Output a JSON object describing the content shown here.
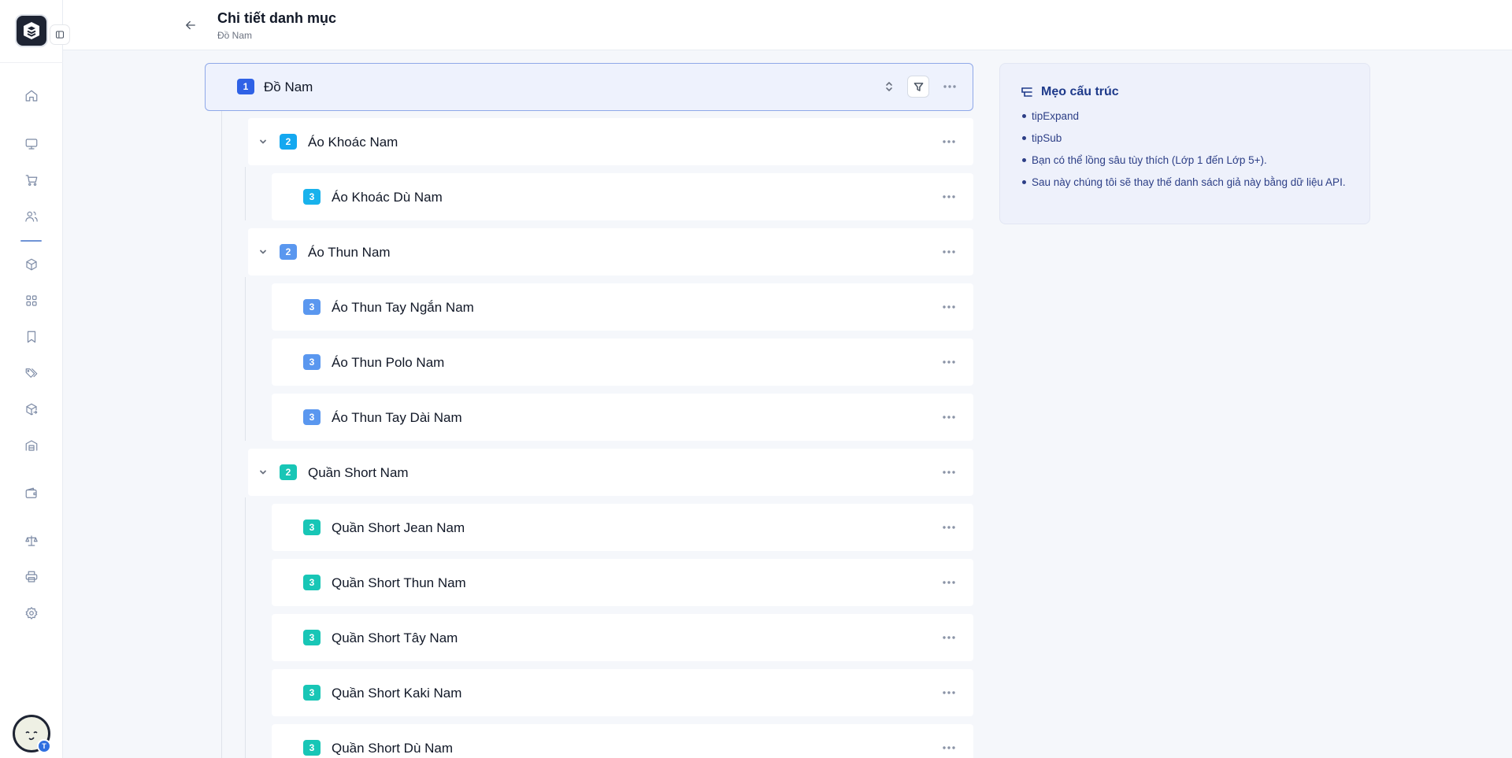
{
  "header": {
    "title": "Chi tiết danh mục",
    "subtitle": "Đồ Nam"
  },
  "sidebar": {
    "logo_icon": "layers-logo-icon",
    "avatar_badge": "T",
    "items": [
      {
        "name": "home-icon"
      },
      {
        "name": "monitor-icon"
      },
      {
        "name": "cart-icon"
      },
      {
        "name": "users-icon"
      },
      {
        "name": "box-icon"
      },
      {
        "name": "grid-icon"
      },
      {
        "name": "bookmark-icon"
      },
      {
        "name": "tags-icon"
      },
      {
        "name": "box-return-icon"
      },
      {
        "name": "warehouse-icon"
      },
      {
        "name": "wallet-icon"
      },
      {
        "name": "scale-icon"
      },
      {
        "name": "printer-icon"
      },
      {
        "name": "settings-icon"
      }
    ]
  },
  "tree": {
    "root": {
      "level": "1",
      "label": "Đồ Nam"
    },
    "items": [
      {
        "level": "2",
        "label": "Áo Khoác Nam"
      },
      {
        "level": "3",
        "label": "Áo Khoác Dù Nam"
      },
      {
        "level": "2",
        "label": "Áo Thun Nam"
      },
      {
        "level": "3",
        "label": "Áo Thun Tay Ngắn Nam"
      },
      {
        "level": "3",
        "label": "Áo Thun Polo Nam"
      },
      {
        "level": "3",
        "label": "Áo Thun Tay Dài Nam"
      },
      {
        "level": "2",
        "label": "Quần Short Nam"
      },
      {
        "level": "3",
        "label": "Quần Short Jean Nam"
      },
      {
        "level": "3",
        "label": "Quần Short Thun Nam"
      },
      {
        "level": "3",
        "label": "Quần Short Tây Nam"
      },
      {
        "level": "3",
        "label": "Quần Short Kaki Nam"
      },
      {
        "level": "3",
        "label": "Quần Short Dù Nam"
      }
    ]
  },
  "tips": {
    "title": "Mẹo cấu trúc",
    "items": [
      "tipExpand",
      "tipSub",
      "Bạn có thể lồng sâu tùy thích (Lớp 1 đến Lớp 5+).",
      "Sau này chúng tôi sẽ thay thế danh sách giả này bằng dữ liệu API."
    ]
  },
  "colors": {
    "accent": "#2f62e6",
    "level2_sky": "#14a8f0",
    "level_blue": "#5a97ef",
    "level_teal": "#18c6b6"
  }
}
